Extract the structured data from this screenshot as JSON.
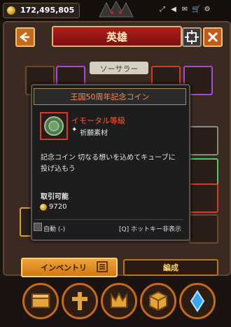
{
  "currency": {
    "gold": "172,495,805",
    "icon": "gold-coin-icon"
  },
  "system_icons": [
    "expand-icon",
    "volume-icon",
    "mail-icon",
    "shop-cart-icon",
    "settings-gear-icon"
  ],
  "header": {
    "title": "英雄",
    "back_icon": "back-arrow-icon",
    "select_icon": "target-icon",
    "close_icon": "close-x-icon"
  },
  "class_tab": {
    "label": "ソーサラー"
  },
  "tooltip": {
    "title": "王国50周年記念コイン",
    "grade": "イモータル等級",
    "type": "祈願素材",
    "description": "記念コイン 切なる想いを込めてキューブに投げ込もう",
    "tradeable": "取引可能",
    "price": "9720",
    "auto": "自動 (-)",
    "hotkey": "[Q] ホットキー非表示"
  },
  "tabs": {
    "inventory": "インベントリ",
    "formation": "編成"
  },
  "nav": [
    "inventory-chest-icon",
    "cross-icon",
    "crown-icon",
    "cube-icon",
    "crystal-icon"
  ],
  "colors": {
    "accent_red": "#b01c1c",
    "immortal_grade": "#ff5b3a",
    "tab_orange": "#f0a23a"
  }
}
